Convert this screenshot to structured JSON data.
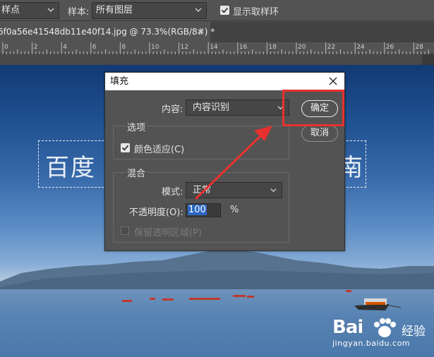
{
  "options_bar": {
    "sample_point_value": "样点",
    "sample_label": "样本:",
    "sample_value": "所有图层",
    "show_ring_label": "显示取样环",
    "show_ring_checked": true
  },
  "document_tab": {
    "title": "6f0a56e41548db11e40f14.jpg @ 73.3%(RGB/8#) *",
    "close": "×"
  },
  "ruler": {
    "labels": [
      "0",
      "2",
      "4",
      "6",
      "8",
      "10",
      "12",
      "14",
      "16",
      "18",
      "20",
      "22",
      "24",
      "26",
      "28"
    ]
  },
  "canvas": {
    "text_left": "百度",
    "text_right": "南"
  },
  "dialog": {
    "title": "填充",
    "content_label": "内容:",
    "content_value": "内容识别",
    "ok_label": "确定",
    "cancel_label": "取消",
    "options_group_title": "选项",
    "color_adapt_label": "颜色适应(C)",
    "color_adapt_checked": true,
    "blend_group_title": "混合",
    "mode_label": "模式:",
    "mode_value": "正常",
    "opacity_label": "不透明度(O):",
    "opacity_value": "100",
    "opacity_unit": "%",
    "preserve_label": "保留透明区域(P)",
    "preserve_enabled": false
  },
  "watermark": {
    "brand": "Bai",
    "brand2": "经验",
    "url": "jingyan.baidu.com"
  },
  "colors": {
    "annotation": "#e8312f",
    "selection_highlight": "#2b66c3"
  }
}
